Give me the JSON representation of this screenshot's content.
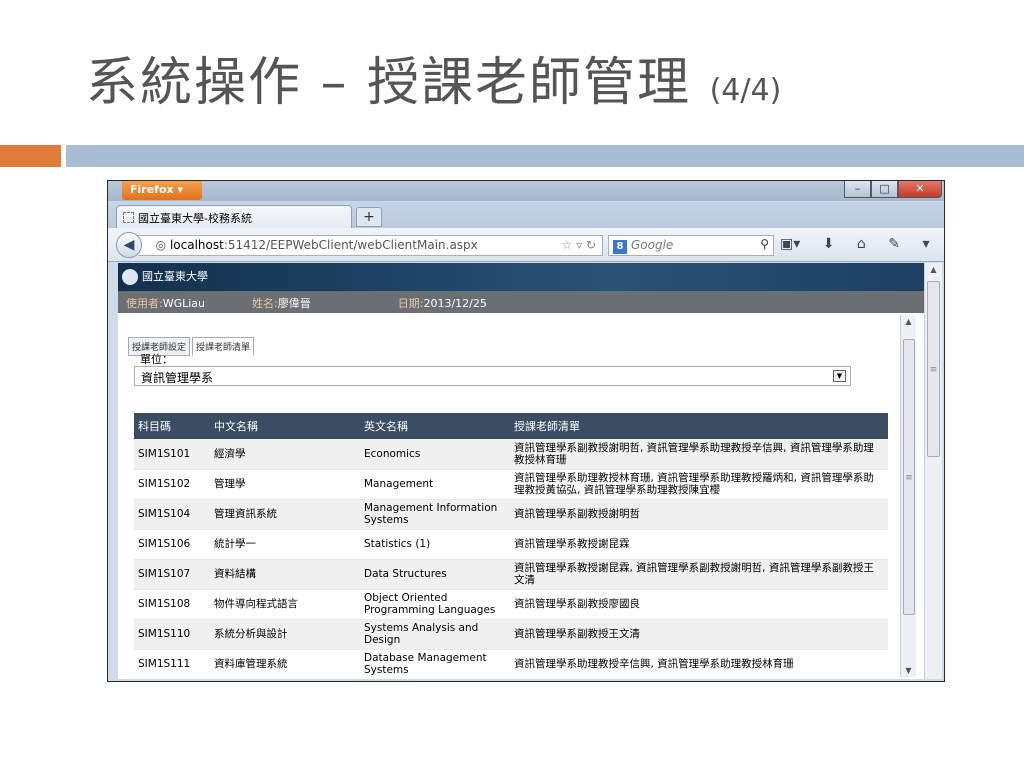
{
  "slide": {
    "title": "系統操作 – 授課老師管理",
    "page_indicator": "(4/4)",
    "accent_orange": "#e07b39",
    "accent_blue": "#a8bdd3"
  },
  "browser": {
    "app_button": "Firefox ▾",
    "tab_title": "國立臺東大學-校務系統",
    "new_tab": "+",
    "url_host": "localhost",
    "url_rest": ":51412/EEPWebClient/webClientMain.aspx",
    "search_engine_icon": "8",
    "search_placeholder": "Google",
    "window_min": "–",
    "window_max": "□",
    "window_close": "✕"
  },
  "app": {
    "logo_text": "國立臺東大學",
    "info": {
      "user_label": "使用者:",
      "user_value": "WGLiau",
      "name_label": "姓名:",
      "name_value": "廖偉晉",
      "date_label": "日期:",
      "date_value": "2013/12/25"
    },
    "tabs": [
      {
        "label": "授課老師設定"
      },
      {
        "label": "授課老師清單"
      }
    ],
    "unit_label": "單位：",
    "unit_value": "資訊管理學系",
    "table": {
      "headers": [
        "科目碼",
        "中文名稱",
        "英文名稱",
        "授課老師清單"
      ],
      "rows": [
        [
          "SIM1S101",
          "經濟學",
          "Economics",
          "資訊管理學系副教授謝明哲, 資訊管理學系助理教授辛信興, 資訊管理學系助理教授林育珊"
        ],
        [
          "SIM1S102",
          "管理學",
          "Management",
          "資訊管理學系助理教授林育珊, 資訊管理學系助理教授羅炳和, 資訊管理學系助理教授黃協弘, 資訊管理學系助理教授陳宜櫻"
        ],
        [
          "SIM1S104",
          "管理資訊系統",
          "Management Information Systems",
          "資訊管理學系副教授謝明哲"
        ],
        [
          "SIM1S106",
          "統計學一",
          "Statistics (1)",
          "資訊管理學系教授謝昆霖"
        ],
        [
          "SIM1S107",
          "資料結構",
          "Data Structures",
          "資訊管理學系教授謝昆霖, 資訊管理學系副教授謝明哲, 資訊管理學系副教授王文清"
        ],
        [
          "SIM1S108",
          "物件導向程式語言",
          "Object Oriented Programming Languages",
          "資訊管理學系副教授廖國良"
        ],
        [
          "SIM1S110",
          "系統分析與設計",
          "Systems Analysis and Design",
          "資訊管理學系副教授王文清"
        ],
        [
          "SIM1S111",
          "資料庫管理系統",
          "Database Management Systems",
          "資訊管理學系助理教授辛信興, 資訊管理學系助理教授林育珊"
        ]
      ]
    }
  }
}
